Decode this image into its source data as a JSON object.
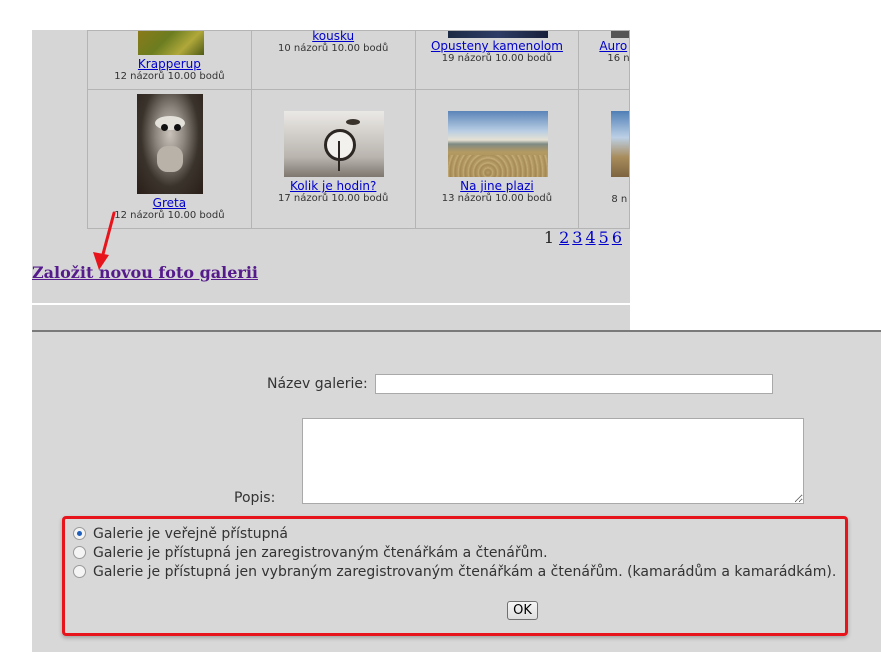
{
  "gallery": {
    "row1": [
      {
        "title": "Krapperup",
        "meta": "12 názorů 10.00 bodů"
      },
      {
        "title": "kousku",
        "meta": "10 názorů 10.00 bodů"
      },
      {
        "title": "Opusteny kamenolom",
        "meta": "19 názorů 10.00 bodů"
      },
      {
        "title": "Auro",
        "meta": "16 n"
      }
    ],
    "row2": [
      {
        "title": "Greta",
        "meta": "12 názorů 10.00 bodů"
      },
      {
        "title": "Kolik je hodin?",
        "meta": "17 názorů 10.00 bodů"
      },
      {
        "title": "Na jine plazi",
        "meta": "13 názorů 10.00 bodů"
      },
      {
        "title": "",
        "meta": "8 n"
      }
    ]
  },
  "pager": {
    "current": "1",
    "pages": [
      "2",
      "3",
      "4",
      "5",
      "6"
    ]
  },
  "create_gallery_link": "Založit novou foto galerii",
  "form": {
    "name_label": "Název galerie:",
    "name_value": "",
    "description_label": "Popis:",
    "description_value": "",
    "access_options": [
      {
        "label": "Galerie je veřejně přístupná",
        "checked": true
      },
      {
        "label": "Galerie je přístupná jen zaregistrovaným čtenářkám a čtenářům.",
        "checked": false
      },
      {
        "label": "Galerie je přístupná jen vybraným zaregistrovaným čtenářkám a čtenářům. (kamarádům a kamarádkám).",
        "checked": false
      }
    ],
    "ok_label": "OK"
  },
  "colors": {
    "link": "#0000cc",
    "visited_link": "#551a8b",
    "highlight_box": "#e8141c",
    "arrow": "#e8141c"
  }
}
